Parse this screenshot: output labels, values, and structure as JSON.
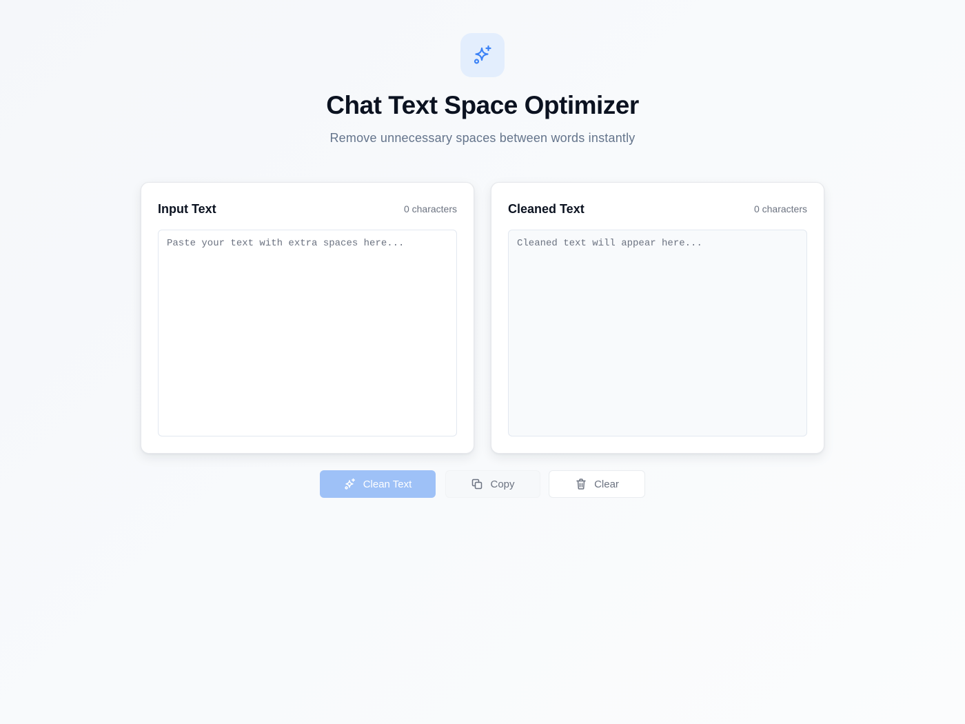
{
  "header": {
    "logo_icon": "sparkles-icon",
    "title": "Chat Text Space Optimizer",
    "subtitle": "Remove unnecessary spaces between words instantly"
  },
  "input_panel": {
    "title": "Input Text",
    "char_count": "0 characters",
    "value": "",
    "placeholder": "Paste your text with extra spaces here..."
  },
  "output_panel": {
    "title": "Cleaned Text",
    "char_count": "0 characters",
    "value": "",
    "placeholder": "Cleaned text will appear here..."
  },
  "actions": {
    "clean_label": "Clean Text",
    "clean_icon": "sparkles-icon",
    "copy_label": "Copy",
    "copy_icon": "copy-icon",
    "clear_label": "Clear",
    "clear_icon": "trash-icon"
  },
  "colors": {
    "accent": "#3b82f6",
    "accent_disabled": "#9ec1f7",
    "logo_tile": "#e3eefd",
    "text_primary": "#0b1220",
    "text_muted": "#64748b"
  }
}
